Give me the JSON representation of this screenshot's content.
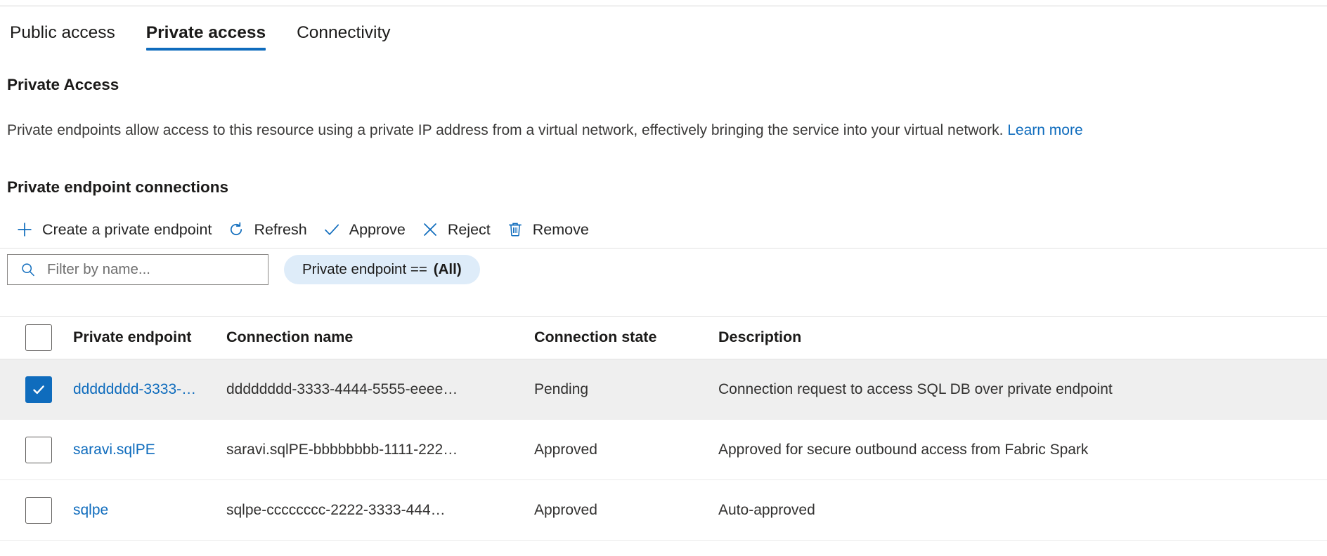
{
  "tabs": [
    {
      "label": "Public access",
      "active": false
    },
    {
      "label": "Private access",
      "active": true
    },
    {
      "label": "Connectivity",
      "active": false
    }
  ],
  "section": {
    "title": "Private Access",
    "description": "Private endpoints allow access to this resource using a private IP address from a virtual network, effectively bringing the service into your virtual network.",
    "learn_more": "Learn more",
    "list_title": "Private endpoint connections"
  },
  "toolbar": {
    "create_label": "Create a private endpoint",
    "create_icon": "plus-icon",
    "refresh_label": "Refresh",
    "refresh_icon": "refresh-icon",
    "approve_label": "Approve",
    "approve_icon": "checkmark-icon",
    "reject_label": "Reject",
    "reject_icon": "close-x-icon",
    "remove_label": "Remove",
    "remove_icon": "trash-icon"
  },
  "filter": {
    "search_placeholder": "Filter by name...",
    "search_value": "",
    "search_icon": "search-icon",
    "pill_key": "Private endpoint ==",
    "pill_value": "(All)"
  },
  "table": {
    "columns": [
      "Private endpoint",
      "Connection name",
      "Connection state",
      "Description"
    ],
    "rows": [
      {
        "selected": true,
        "endpoint": "dddddddd-3333-…",
        "connection_name": "dddddddd-3333-4444-5555-eeee…",
        "connection_state": "Pending",
        "description": "Connection request to access SQL DB over private endpoint"
      },
      {
        "selected": false,
        "endpoint": "saravi.sqlPE",
        "connection_name": "saravi.sqlPE-bbbbbbbb-1111-222…",
        "connection_state": "Approved",
        "description": "Approved for secure outbound access from Fabric Spark"
      },
      {
        "selected": false,
        "endpoint": "sqlpe",
        "connection_name": "sqlpe-cccccccc-2222-3333-444…",
        "connection_state": "Approved",
        "description": "Auto-approved"
      }
    ]
  },
  "colors": {
    "accent": "#0f6cbd",
    "selected_row": "#efefef",
    "pill_bg": "#deecf9"
  }
}
